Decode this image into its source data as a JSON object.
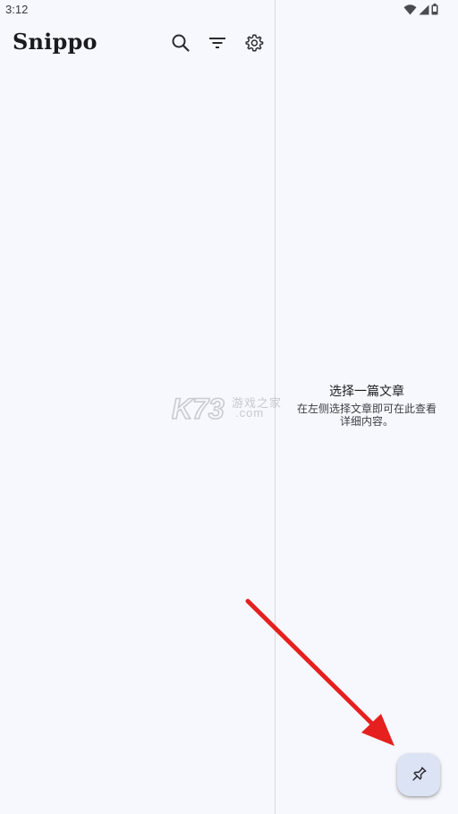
{
  "status_bar": {
    "time": "3:12",
    "icons": [
      "wifi-icon",
      "signal-icon",
      "battery-icon"
    ]
  },
  "header": {
    "app_title": "Snippo",
    "actions": [
      {
        "icon": "search-icon"
      },
      {
        "icon": "filter-icon"
      },
      {
        "icon": "gear-icon"
      }
    ]
  },
  "detail_pane": {
    "empty_title": "选择一篇文章",
    "empty_description": "在左侧选择文章即可在此查看详细内容。"
  },
  "watermark": {
    "brand": "K73",
    "cn_text": "游戏之家",
    "domain_text": ".com"
  },
  "fab": {
    "icon": "pin-icon"
  },
  "colors": {
    "background": "#F7F8FD",
    "divider": "#D8D8DE",
    "fab_background": "#DCE3F4",
    "annotation_arrow": "#E5201F"
  }
}
